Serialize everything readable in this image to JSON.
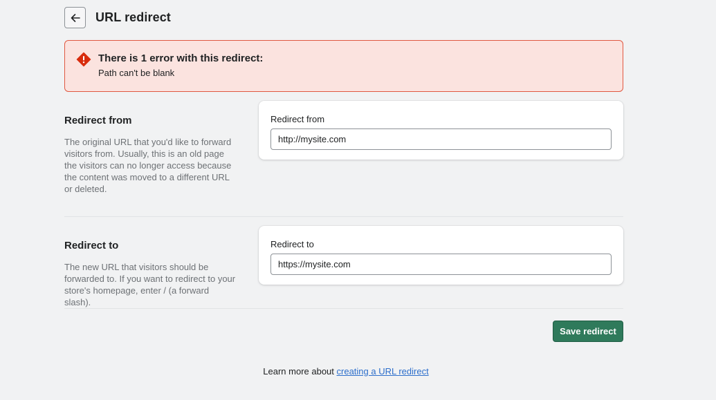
{
  "header": {
    "back_icon": "arrow-left-icon",
    "title": "URL redirect"
  },
  "banner": {
    "icon": "alert-diamond-icon",
    "title": "There is 1 error with this redirect:",
    "message": "Path can't be blank",
    "colors": {
      "background": "#fbe3df",
      "border": "#e0573f",
      "icon": "#d82c0d"
    }
  },
  "redirect_from": {
    "title": "Redirect from",
    "description": "The original URL that you'd like to forward visitors from. Usually, this is an old page the visitors can no longer access because the content was moved to a different URL or deleted.",
    "field_label": "Redirect from",
    "value": "http://mysite.com"
  },
  "redirect_to": {
    "title": "Redirect to",
    "description": "The new URL that visitors should be forwarded to. If you want to redirect to your store's homepage, enter / (a forward slash).",
    "field_label": "Redirect to",
    "value": "https://mysite.com"
  },
  "actions": {
    "save_label": "Save redirect",
    "save_color": "#2f7a5b"
  },
  "footer": {
    "prefix": "Learn more about ",
    "link_text": "creating a URL redirect"
  }
}
